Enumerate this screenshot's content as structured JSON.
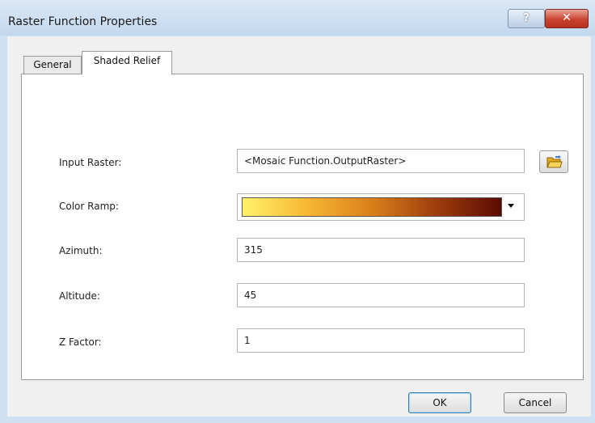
{
  "window": {
    "title": "Raster Function Properties",
    "help_label": "?",
    "close_label": "✕"
  },
  "tabs": [
    {
      "label": "General",
      "selected": false
    },
    {
      "label": "Shaded Relief",
      "selected": true
    }
  ],
  "form": {
    "input_raster": {
      "label": "Input Raster:",
      "value": "<Mosaic Function.OutputRaster>"
    },
    "color_ramp": {
      "label": "Color Ramp:",
      "gradient": [
        "#fff36a",
        "#f7b733",
        "#d9801a",
        "#9e3d0d",
        "#5a0b02"
      ]
    },
    "azimuth": {
      "label": "Azimuth:",
      "value": "315"
    },
    "altitude": {
      "label": "Altitude:",
      "value": "45"
    },
    "z_factor": {
      "label": "Z Factor:",
      "value": "1"
    }
  },
  "buttons": {
    "ok_label": "OK",
    "cancel_label": "Cancel"
  },
  "colors": {
    "titlebar": "#cfe0f2",
    "close_button": "#c9432f",
    "folder_icon": "#f2c230"
  }
}
